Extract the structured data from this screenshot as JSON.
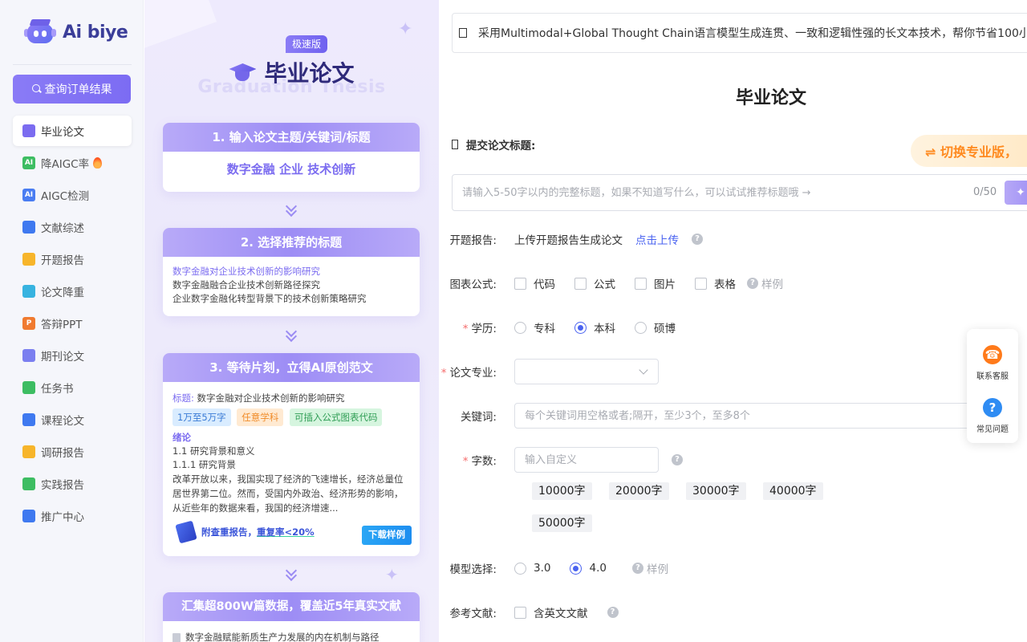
{
  "brand": {
    "name": "Ai biye"
  },
  "sidebar": {
    "query_button": "查询订单结果",
    "items": [
      {
        "label": "毕业论文",
        "icon": "graduation-cap-icon",
        "color": "#7b6cf0",
        "active": true
      },
      {
        "label": "降AIGC率",
        "icon": "ai-badge-icon",
        "color": "#3dbd62",
        "hot": true,
        "glyph": "AI"
      },
      {
        "label": "AIGC检测",
        "icon": "ai-detect-icon",
        "color": "#4a7df2",
        "glyph": "AI"
      },
      {
        "label": "文献综述",
        "icon": "book-icon",
        "color": "#3f79f0"
      },
      {
        "label": "开题报告",
        "icon": "report-icon",
        "color": "#f7b52a"
      },
      {
        "label": "论文降重",
        "icon": "chart-down-icon",
        "color": "#37b3e0"
      },
      {
        "label": "答辩PPT",
        "icon": "ppt-icon",
        "color": "#f07a2f",
        "glyph": "P"
      },
      {
        "label": "期刊论文",
        "icon": "journal-icon",
        "color": "#7b7ff0"
      },
      {
        "label": "任务书",
        "icon": "checklist-icon",
        "color": "#3dbd62"
      },
      {
        "label": "课程论文",
        "icon": "course-book-icon",
        "color": "#3f79f0"
      },
      {
        "label": "调研报告",
        "icon": "survey-icon",
        "color": "#f7b52a"
      },
      {
        "label": "实践报告",
        "icon": "practice-icon",
        "color": "#3dbd62"
      },
      {
        "label": "推广中心",
        "icon": "paper-plane-icon",
        "color": "#3f79f0"
      }
    ]
  },
  "promo": {
    "badge": "极速版",
    "title": "毕业论文",
    "ghost_title": "Graduation Thesis",
    "step1": {
      "head": "1. 输入论文主题/关键词/标题",
      "body": "数字金融 企业 技术创新"
    },
    "step2": {
      "head": "2. 选择推荐的标题",
      "titles": [
        "数字金融对企业技术创新的影响研究",
        "数字金融融合企业技术创新路径探究",
        "企业数字金融化转型背景下的技术创新策略研究"
      ]
    },
    "step3": {
      "head": "3. 等待片刻，立得AI原创范文",
      "title_label": "标题:",
      "title_value": "数字金融对企业技术创新的影响研究",
      "tags": [
        "1万至5万字",
        "任意学科",
        "可插入公式图表代码"
      ],
      "section": "绪论",
      "lines": [
        "1.1 研究背景和意义",
        "1.1.1 研究背景"
      ],
      "paragraph": "改革开放以来，我国实现了经济的飞速增长，经济总量位居世界第二位。然而，受国内外政治、经济形势的影响，从近些年的数据来看，我国的经济增速...",
      "check_report": "附查重报告，",
      "check_rate": "重复率<20%",
      "download": "下载样例"
    },
    "step4": {
      "head": "汇集超800W篇数据，覆盖近5年真实文献",
      "first_line": "数字金融赋能新质生产力发展的内在机制与路径"
    }
  },
  "main": {
    "notice": "采用Multimodal+Global Thought Chain语言模型生成连贯、一致和逻辑性强的长文本技术，帮你节省100小",
    "page_title": "毕业论文",
    "submit_label": "提交论文标题:",
    "switch_pro": "⇌ 切换专业版，",
    "title_placeholder": "请输入5-50字以内的完整标题，如果不知道写什么，可以试试推荐标题哦 →",
    "title_counter": "0/50",
    "proposal": {
      "label": "开题报告:",
      "text": "上传开题报告生成论文",
      "link": "点击上传"
    },
    "charts": {
      "label": "图表公式:",
      "options": [
        "代码",
        "公式",
        "图片",
        "表格"
      ],
      "sample": "样例"
    },
    "degree": {
      "label": "学历:",
      "options": [
        "专科",
        "本科",
        "硕博"
      ],
      "selected": "本科"
    },
    "major": {
      "label": "论文专业:"
    },
    "keywords": {
      "label": "关键词:",
      "placeholder": "每个关键词用空格或者;隔开，至少3个，至多8个"
    },
    "wordcount": {
      "label": "字数:",
      "placeholder": "输入自定义",
      "options": [
        "10000字",
        "20000字",
        "30000字",
        "40000字",
        "50000字"
      ]
    },
    "model": {
      "label": "模型选择:",
      "options": [
        "3.0",
        "4.0"
      ],
      "selected": "4.0",
      "sample": "样例"
    },
    "references": {
      "label": "参考文献:",
      "option": "含英文文献"
    }
  },
  "float": {
    "service": "联系客服",
    "faq": "常见问题"
  },
  "colors": {
    "accent": "#7c6cf3",
    "link": "#4a63f0",
    "required": "#f56c6c",
    "pro_orange": "#ff8a1f"
  }
}
